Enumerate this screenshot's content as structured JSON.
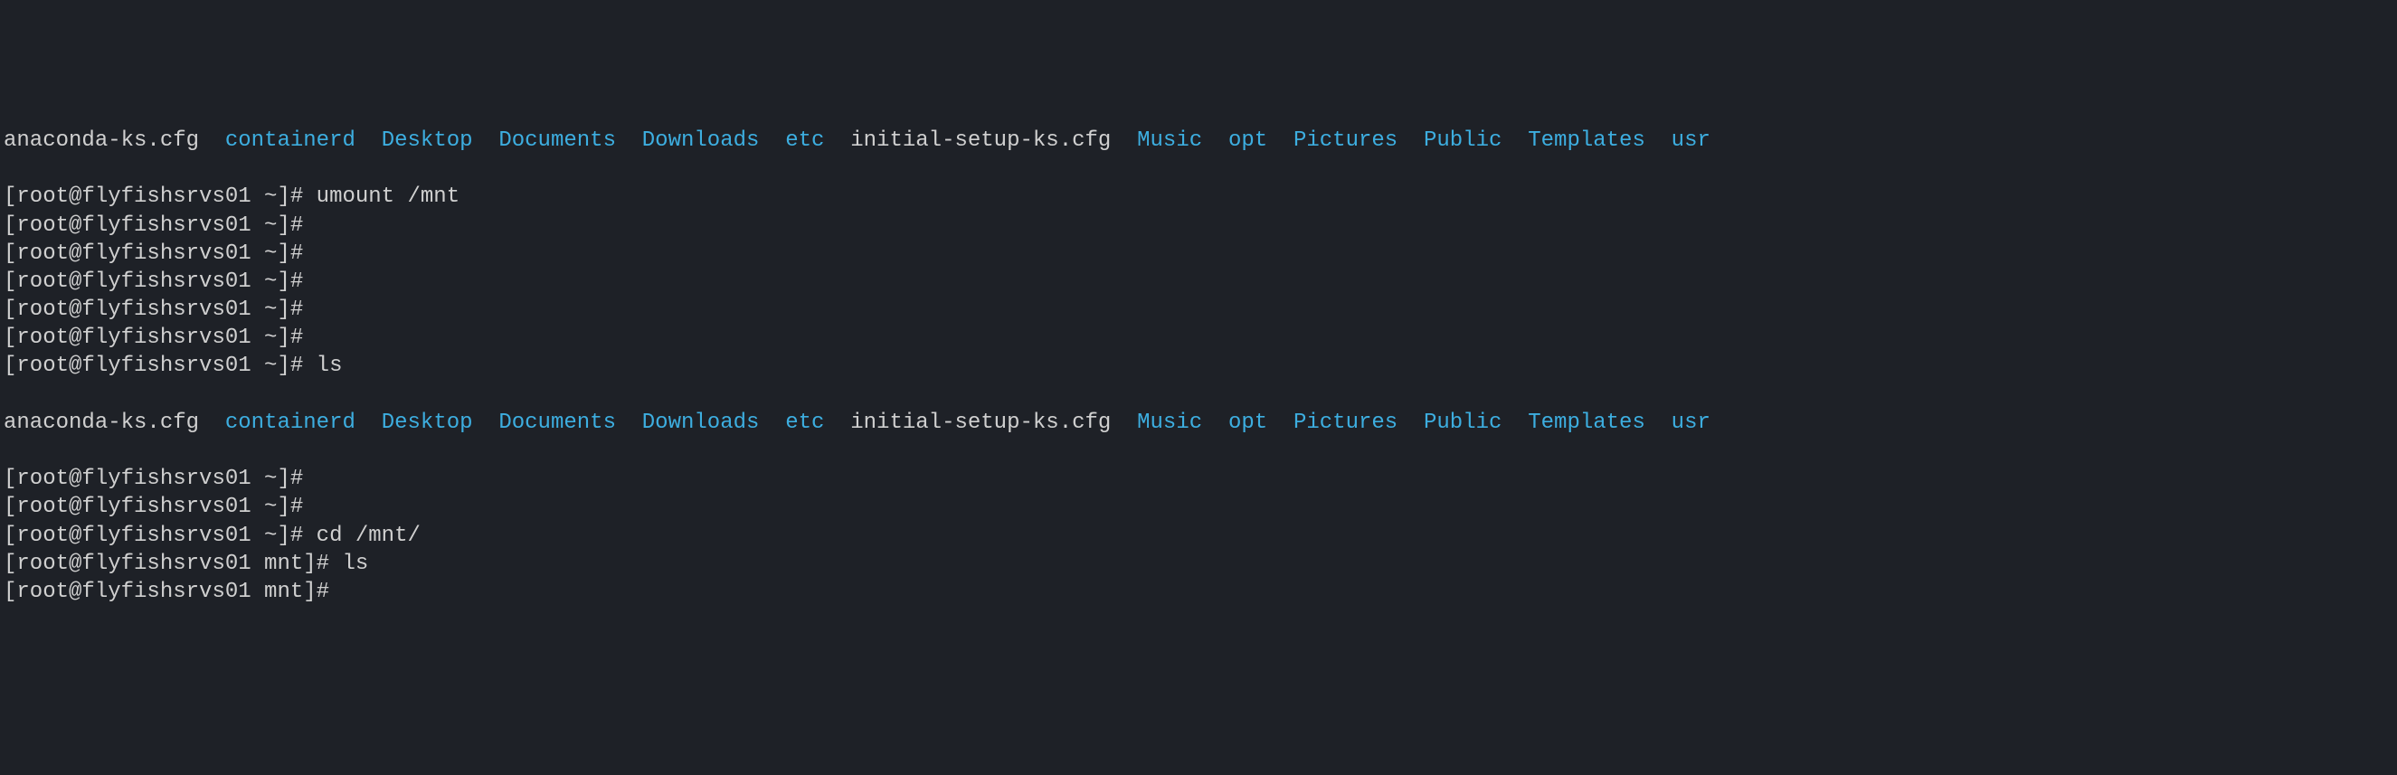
{
  "top_row": {
    "items": [
      {
        "text": "anaconda-ks.cfg",
        "cls": "top-white"
      },
      {
        "text": "containerd",
        "cls": "top-partial"
      },
      {
        "text": "Desktop",
        "cls": "top-partial"
      },
      {
        "text": "Documents",
        "cls": "top-partial"
      },
      {
        "text": "Downloads",
        "cls": "top-partial"
      },
      {
        "text": "etc",
        "cls": "top-partial"
      },
      {
        "text": "initial-setup-ks.cfg",
        "cls": "top-white"
      },
      {
        "text": "Music",
        "cls": "top-partial"
      },
      {
        "text": "opt",
        "cls": "top-partial"
      },
      {
        "text": "Pictures",
        "cls": "top-partial"
      },
      {
        "text": "Public",
        "cls": "top-partial"
      },
      {
        "text": "Templates",
        "cls": "top-partial"
      },
      {
        "text": "usr",
        "cls": "top-partial"
      }
    ]
  },
  "lines": [
    {
      "prompt": "[root@flyfishsrvs01 ~]#",
      "cmd": " umount /mnt"
    },
    {
      "prompt": "[root@flyfishsrvs01 ~]#",
      "cmd": ""
    },
    {
      "prompt": "[root@flyfishsrvs01 ~]#",
      "cmd": ""
    },
    {
      "prompt": "[root@flyfishsrvs01 ~]#",
      "cmd": ""
    },
    {
      "prompt": "[root@flyfishsrvs01 ~]#",
      "cmd": ""
    },
    {
      "prompt": "[root@flyfishsrvs01 ~]#",
      "cmd": ""
    },
    {
      "prompt": "[root@flyfishsrvs01 ~]#",
      "cmd": " ls"
    }
  ],
  "ls_output": {
    "items": [
      {
        "text": "anaconda-ks.cfg",
        "cls": "white"
      },
      {
        "text": "containerd",
        "cls": "dir-blue"
      },
      {
        "text": "Desktop",
        "cls": "dir-blue"
      },
      {
        "text": "Documents",
        "cls": "dir-blue"
      },
      {
        "text": "Downloads",
        "cls": "dir-blue"
      },
      {
        "text": "etc",
        "cls": "dir-blue"
      },
      {
        "text": "initial-setup-ks.cfg",
        "cls": "white"
      },
      {
        "text": "Music",
        "cls": "dir-blue"
      },
      {
        "text": "opt",
        "cls": "dir-blue"
      },
      {
        "text": "Pictures",
        "cls": "dir-blue"
      },
      {
        "text": "Public",
        "cls": "dir-blue"
      },
      {
        "text": "Templates",
        "cls": "dir-blue"
      },
      {
        "text": "usr",
        "cls": "dir-blue"
      }
    ]
  },
  "lines_after": [
    {
      "prompt": "[root@flyfishsrvs01 ~]#",
      "cmd": ""
    },
    {
      "prompt": "[root@flyfishsrvs01 ~]#",
      "cmd": ""
    },
    {
      "prompt": "[root@flyfishsrvs01 ~]#",
      "cmd": " cd /mnt/"
    },
    {
      "prompt": "[root@flyfishsrvs01 mnt]#",
      "cmd": " ls"
    },
    {
      "prompt": "[root@flyfishsrvs01 mnt]#",
      "cmd": ""
    }
  ]
}
